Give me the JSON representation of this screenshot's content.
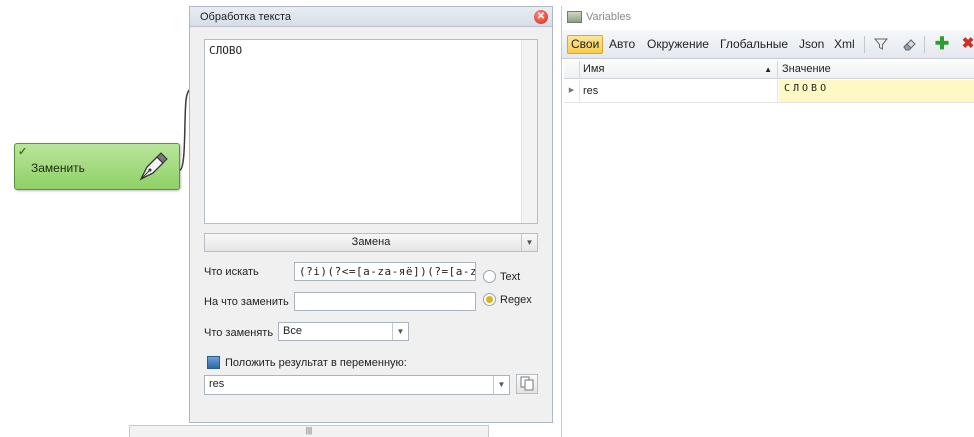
{
  "canvas": {
    "action_block": {
      "label": "Заменить",
      "status": "ok"
    }
  },
  "dialog": {
    "title": "Обработка текста",
    "text_content": "СЛОВО",
    "mode_select": "Замена",
    "find_label": "Что искать",
    "find_value": "(?i)(?<=[a-za-яё])(?=[a-z",
    "replace_label": "На что заменить",
    "replace_value": "",
    "radio_text": "Text",
    "radio_regex": "Regex",
    "selected_mode": "Regex",
    "what_replace_label": "Что заменять",
    "what_replace_value": "Все",
    "put_result_label": "Положить результат в переменную:",
    "result_var": "res"
  },
  "variables": {
    "title": "Variables",
    "tabs": [
      "Свои",
      "Авто",
      "Окружение",
      "Глобальные",
      "Json",
      "Xml"
    ],
    "active_tab": "Свои",
    "columns": {
      "name": "Имя",
      "value": "Значение"
    },
    "rows": [
      {
        "name": "res",
        "value": "СЛОВО"
      }
    ],
    "toolbar_icons": [
      "filter-icon",
      "eraser-icon",
      "add-icon",
      "delete-icon"
    ],
    "accent": "#f8cc4a",
    "value_highlight": "#fdf8c4"
  },
  "scroll_grip": "|||"
}
